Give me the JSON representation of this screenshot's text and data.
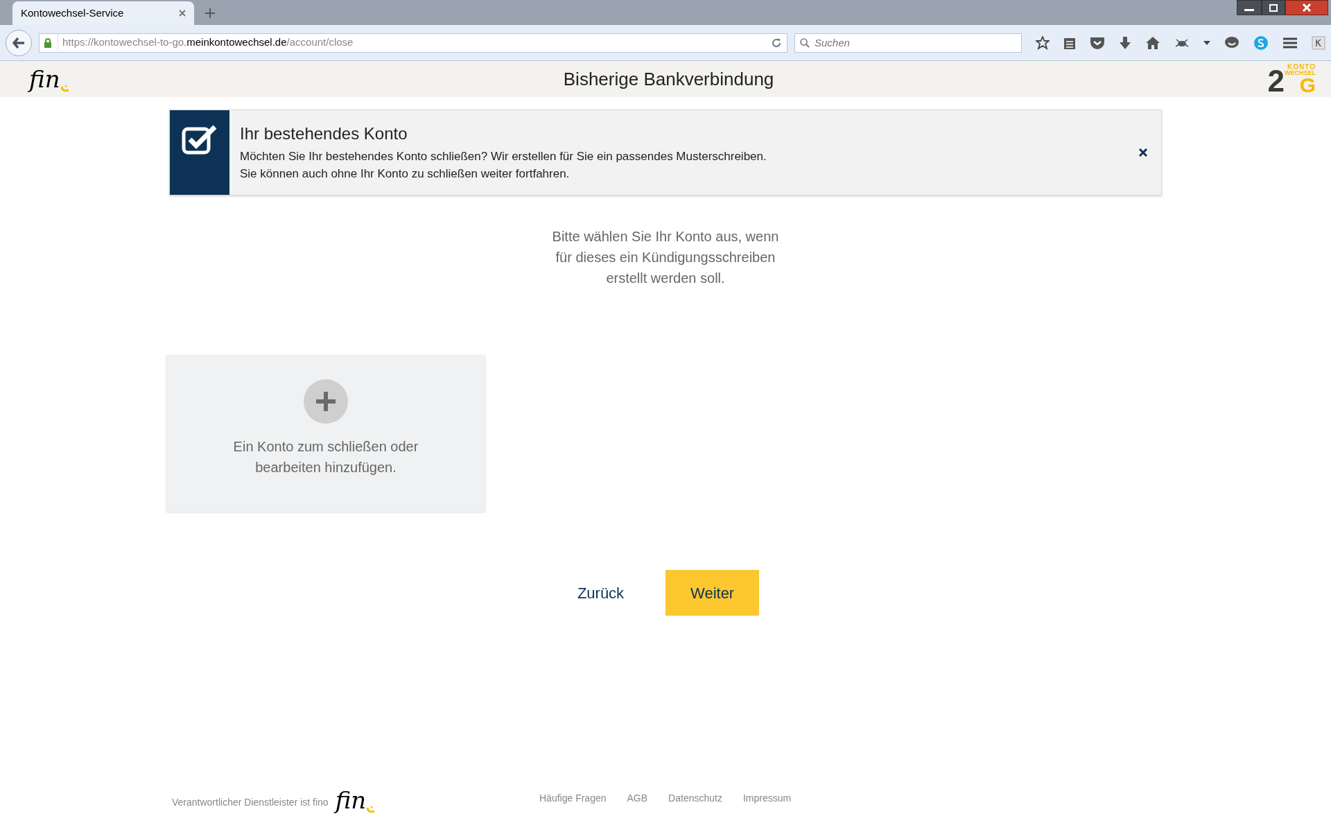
{
  "browser": {
    "tab": {
      "title": "Kontowechsel-Service",
      "selected": true
    },
    "url": {
      "host_prefix": "https://kontowechsel-to-go.",
      "host_main": "meinkontowechsel.de",
      "path": "/account/close"
    },
    "search": {
      "placeholder": "Suchen"
    }
  },
  "header": {
    "logo_left": "fin",
    "title": "Bisherige Bankverbindung",
    "logo_right": {
      "big": "2",
      "mid": "G",
      "top": "KONTO",
      "sub": "WECHSEL"
    }
  },
  "banner": {
    "title": "Ihr bestehendes Konto",
    "lines": [
      "Möchten Sie Ihr bestehendes Konto schließen? Wir erstellen für Sie ein passendes Musterschreiben.",
      "Sie können auch ohne Ihr Konto zu schließen weiter fortfahren."
    ]
  },
  "instruction": "Bitte wählen Sie Ihr Konto aus, wenn für dieses ein Kündigungsschreiben erstellt werden soll.",
  "add_card": {
    "label": "Ein Konto zum schließen oder bearbeiten hinzufügen."
  },
  "buttons": [
    {
      "kind": "link",
      "label": "Zurück"
    },
    {
      "kind": "primary",
      "label": "Weiter"
    }
  ],
  "footer": {
    "provider": "Verantwortlicher Dienstleister ist fino",
    "logo": "fin",
    "links": [
      "Häufige Fragen",
      "AGB",
      "Datenschutz",
      "Impressum"
    ]
  }
}
